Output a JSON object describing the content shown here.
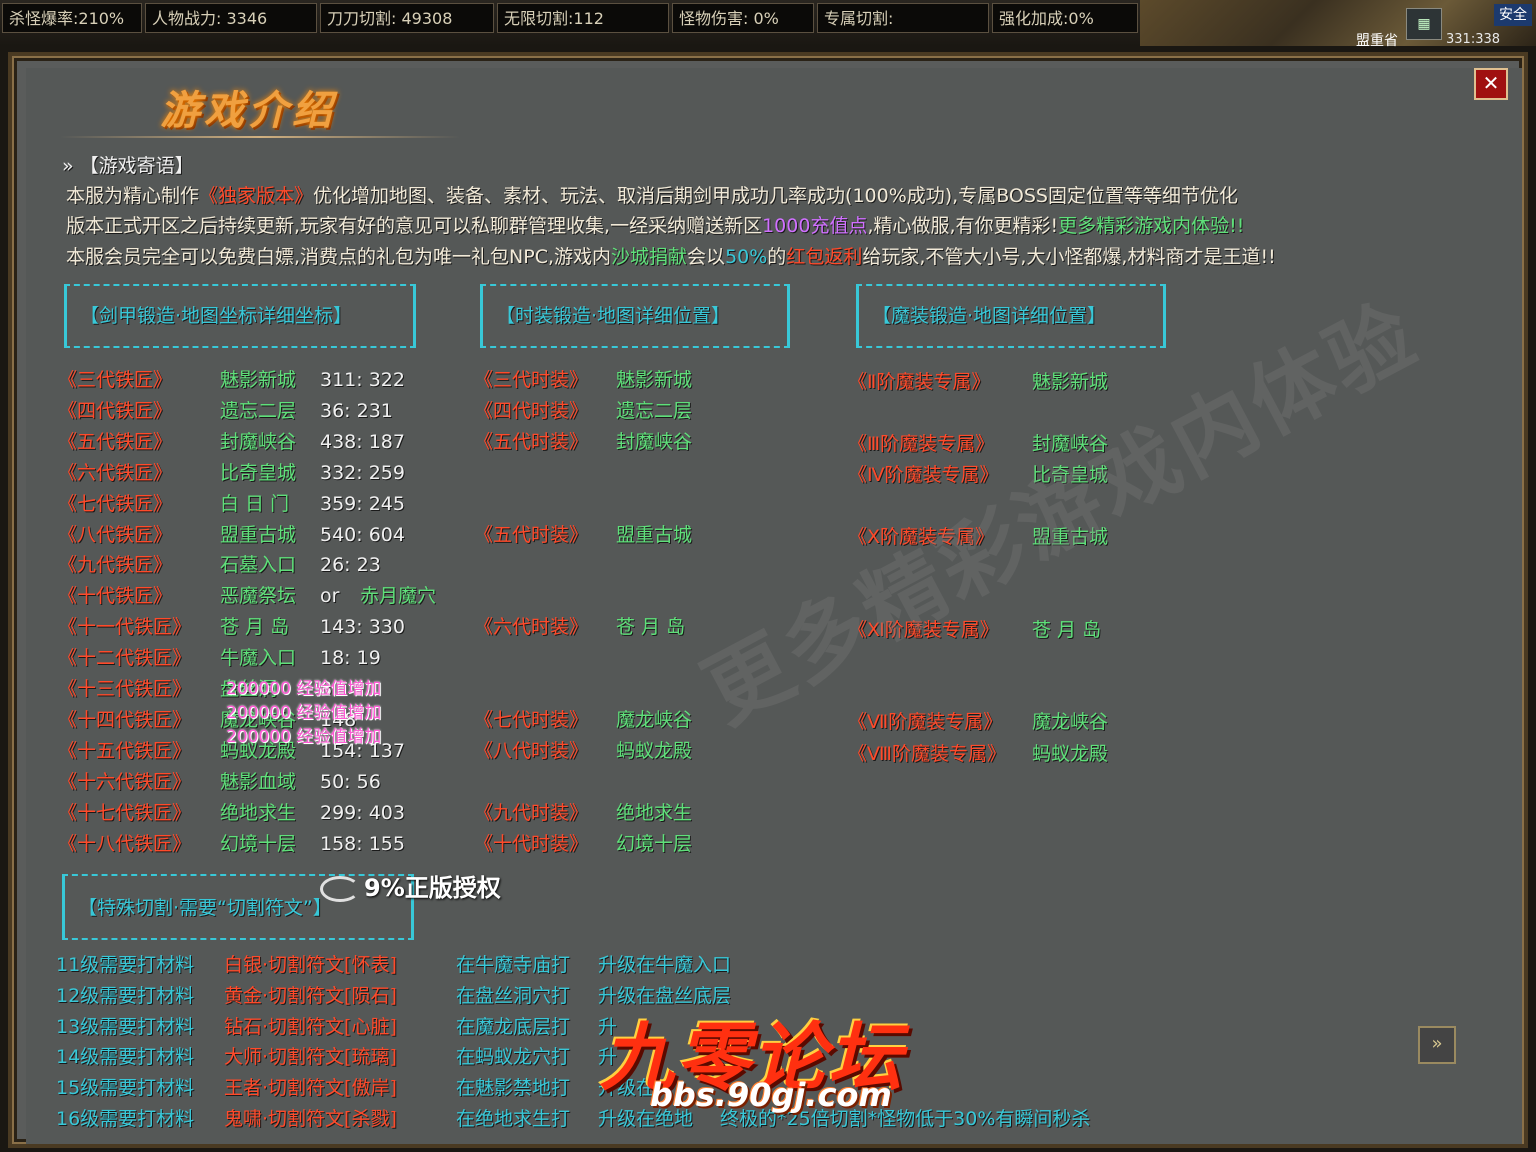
{
  "topbar": {
    "stats": [
      {
        "label": "杀怪爆率:210%"
      },
      {
        "label": "人物战力: 3346"
      },
      {
        "label": "刀刀切割: 49308"
      },
      {
        "label": "无限切割:112"
      },
      {
        "label": "怪物伤害:  0%"
      },
      {
        "label": "专属切割:"
      },
      {
        "label": "强化加成:0%"
      }
    ],
    "safe": "安全",
    "map_name": "盟重省",
    "map_coord": "331:338"
  },
  "panel": {
    "title": "游戏介绍",
    "close": "✕",
    "section_head": "» 【游戏寄语】",
    "intro": {
      "line1_a": "本服为精心制作",
      "line1_b": "《独家版本》",
      "line1_c": "优化增加地图、装备、素材、玩法、取消后期剑甲成功几率成功(100%成功),专属BOSS固定位置等等细节优化",
      "line2_a": "版本正式开区之后持续更新,玩家有好的意见可以私聊群管理收集,一经采纳赠送新区",
      "line2_b": "1000充值点",
      "line2_c": ",精心做服,有你更精彩!",
      "line2_d": "更多精彩游戏内体验!!",
      "line3_a": "本服会员完全可以免费白嫖,消费点的礼包为唯一礼包NPC,游戏内",
      "line3_b": "沙城捐献",
      "line3_c": "会以",
      "line3_d": "50%",
      "line3_e": "的",
      "line3_f": "红包返利",
      "line3_g": "给玩家,不管大小号,大小怪都爆,材料商才是王道!!"
    },
    "box1": "【剑甲锻造·地图坐标详细坐标】",
    "box2": "【时装锻造·地图详细位置】",
    "box3": "【魔装锻造·地图详细位置】",
    "box4": "【特殊切割·需要“切割符文”】",
    "smiths": [
      {
        "name": "《三代铁匠》",
        "map": "魅影新城",
        "coord": "311: 322"
      },
      {
        "name": "《四代铁匠》",
        "map": "遗忘二层",
        "coord": "36: 231"
      },
      {
        "name": "《五代铁匠》",
        "map": "封魔峡谷",
        "coord": "438: 187"
      },
      {
        "name": "《六代铁匠》",
        "map": "比奇皇城",
        "coord": "332: 259"
      },
      {
        "name": "《七代铁匠》",
        "map": "白 日 门",
        "coord": "359: 245"
      },
      {
        "name": "《八代铁匠》",
        "map": "盟重古城",
        "coord": "540: 604"
      },
      {
        "name": "《九代铁匠》",
        "map": "石墓入口",
        "coord": "26: 23"
      },
      {
        "name": "《十代铁匠》",
        "map": "恶魔祭坛",
        "coord": "or",
        "extra": "赤月魔穴"
      },
      {
        "name": "《十一代铁匠》",
        "map": "苍 月 岛",
        "coord": "143: 330"
      },
      {
        "name": "《十二代铁匠》",
        "map": "牛魔入口",
        "coord": "18: 19"
      },
      {
        "name": "《十三代铁匠》",
        "map": "盘丝洞",
        "coord": "8"
      },
      {
        "name": "《十四代铁匠》",
        "map": "魔龙峡谷",
        "coord": "148"
      },
      {
        "name": "《十五代铁匠》",
        "map": "蚂蚁龙殿",
        "coord": "154: 137"
      },
      {
        "name": "《十六代铁匠》",
        "map": "魅影血域",
        "coord": "50: 56"
      },
      {
        "name": "《十七代铁匠》",
        "map": "绝地求生",
        "coord": "299: 403"
      },
      {
        "name": "《十八代铁匠》",
        "map": "幻境十层",
        "coord": "158: 155"
      }
    ],
    "fashion": [
      {
        "name": "《三代时装》",
        "map": "魅影新城"
      },
      {
        "name": "《四代时装》",
        "map": "遗忘二层"
      },
      {
        "name": "《五代时装》",
        "map": "封魔峡谷"
      },
      {
        "name": "《五代时装》",
        "map": "盟重古城"
      },
      {
        "name": "《六代时装》",
        "map": "苍 月 岛"
      },
      {
        "name": "《七代时装》",
        "map": "魔龙峡谷"
      },
      {
        "name": "《八代时装》",
        "map": "蚂蚁龙殿"
      },
      {
        "name": "《九代时装》",
        "map": "绝地求生"
      },
      {
        "name": "《十代时装》",
        "map": "幻境十层"
      }
    ],
    "magic": [
      {
        "name": "《Ⅱ阶魔装专属》",
        "map": "魅影新城"
      },
      {
        "name": "《Ⅲ阶魔装专属》",
        "map": "封魔峡谷"
      },
      {
        "name": "《Ⅳ阶魔装专属》",
        "map": "比奇皇城"
      },
      {
        "name": "《Ⅹ阶魔装专属》",
        "map": "盟重古城"
      },
      {
        "name": "《Ⅺ阶魔装专属》",
        "map": "苍 月 岛"
      },
      {
        "name": "《Ⅶ阶魔装专属》",
        "map": "魔龙峡谷"
      },
      {
        "name": "《Ⅷ阶魔装专属》",
        "map": "蚂蚁龙殿"
      }
    ],
    "exp_popups": [
      "200000 经验值增加",
      "200000 经验值增加",
      "200000 经验值增加"
    ],
    "cutting": [
      {
        "level": "11级需要打材料",
        "item": "白银·切割符文[怀表]",
        "where": "在牛魔寺庙打",
        "up": "升级在牛魔入口"
      },
      {
        "level": "12级需要打材料",
        "item": "黄金·切割符文[陨石]",
        "where": "在盘丝洞穴打",
        "up": "升级在盘丝底层"
      },
      {
        "level": "13级需要打材料",
        "item": "钻石·切割符文[心脏]",
        "where": "在魔龙底层打",
        "up": "升"
      },
      {
        "level": "14级需要打材料",
        "item": "大师·切割符文[琉璃]",
        "where": "在蚂蚁龙穴打",
        "up": "升"
      },
      {
        "level": "15级需要打材料",
        "item": "王者·切割符文[傲岸]",
        "where": "在魅影禁地打",
        "up": "升级在"
      },
      {
        "level": "16级需要打材料",
        "item": "鬼啸·切割符文[杀戮]",
        "where": "在绝地求生打",
        "up": "升级在绝地",
        "note": "终极的*25倍切割*怪物低于30%有瞬间秒杀"
      }
    ],
    "watermark": "更多精彩游戏内体验",
    "badge": "9%正版授权",
    "forum_logo": "九零论坛",
    "forum_url": "bbs.90gj.com",
    "next": "»"
  }
}
